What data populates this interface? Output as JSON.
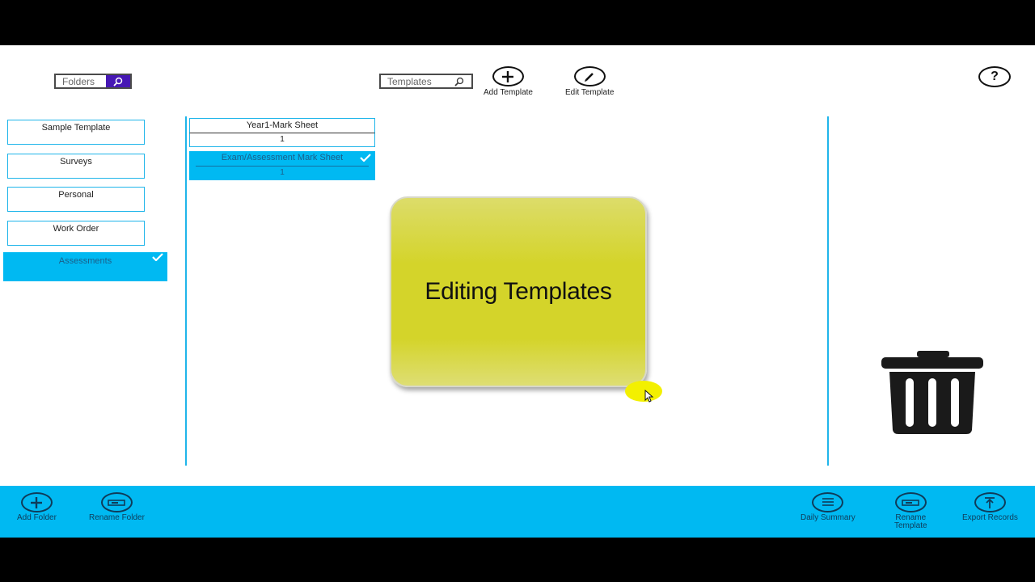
{
  "search": {
    "folders_placeholder": "Folders",
    "templates_placeholder": "Templates"
  },
  "toolbar": {
    "add_template_label": "Add Template",
    "edit_template_label": "Edit Template",
    "help_label": "?"
  },
  "folders": [
    {
      "label": "Sample Template",
      "selected": false
    },
    {
      "label": "Surveys",
      "selected": false
    },
    {
      "label": "Personal",
      "selected": false
    },
    {
      "label": "Work Order",
      "selected": false
    },
    {
      "label": "Assessments",
      "selected": true
    }
  ],
  "templates": [
    {
      "name": "Year1-Mark Sheet",
      "count": "1",
      "selected": false
    },
    {
      "name": "Exam/Assessment Mark Sheet",
      "count": "1",
      "selected": true
    }
  ],
  "overlay": {
    "text": "Editing Templates"
  },
  "appbar": {
    "add_folder_label": "Add Folder",
    "rename_folder_label": "Rename Folder",
    "daily_summary_label": "Daily Summary",
    "rename_template_line1": "Rename",
    "rename_template_line2": "Template",
    "export_records_label": "Export Records"
  },
  "colors": {
    "accent": "#00b9f2",
    "search_button": "#4617b4",
    "overlay_yellow": "#d4d42a"
  },
  "icons": {
    "folders_search": "search-icon",
    "templates_search": "search-icon",
    "add_template": "plus-icon",
    "edit_template": "pencil-icon",
    "help": "question-icon",
    "trash": "trash-icon",
    "add_folder": "plus-icon",
    "rename_folder": "rename-icon",
    "daily_summary": "list-icon",
    "rename_template": "rename-icon",
    "export_records": "export-icon"
  }
}
